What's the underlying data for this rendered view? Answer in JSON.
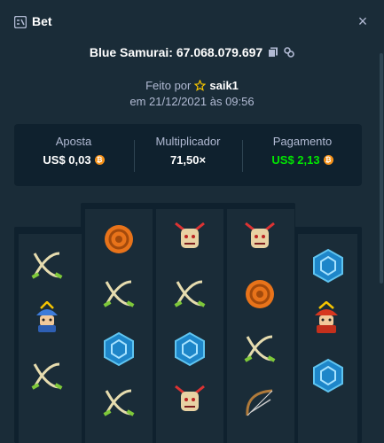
{
  "header": {
    "title": "Bet",
    "close_label": "×"
  },
  "game": {
    "title": "Blue Samurai: 67.068.079.697"
  },
  "meta": {
    "made_by": "Feito por",
    "user": "saik1",
    "date": "em 21/12/2021 às 09:56"
  },
  "stats": {
    "bet_label": "Aposta",
    "bet_value": "US$ 0,03",
    "multiplier_label": "Multiplicador",
    "multiplier_value": "71,50×",
    "payout_label": "Pagamento",
    "payout_value": "US$ 2,13"
  },
  "colors": {
    "background": "#1a2c38",
    "panel": "#0f212e",
    "muted_text": "#b1bad3",
    "payout_green": "#00e701",
    "coin_orange": "#f7931a"
  },
  "reels": [
    [
      "crossed-swords-icon",
      "blue-samurai-helmet-icon",
      "crossed-swords-icon"
    ],
    [
      "orange-target-icon",
      "crossed-swords-icon",
      "blue-hex-gem-icon",
      "crossed-swords-icon"
    ],
    [
      "oni-mask-icon",
      "crossed-swords-icon",
      "blue-hex-gem-icon",
      "oni-mask-icon"
    ],
    [
      "oni-mask-icon",
      "orange-target-icon",
      "crossed-swords-icon",
      "bow-icon"
    ],
    [
      "blue-hex-gem-icon",
      "red-samurai-helmet-icon",
      "blue-hex-gem-icon"
    ]
  ]
}
